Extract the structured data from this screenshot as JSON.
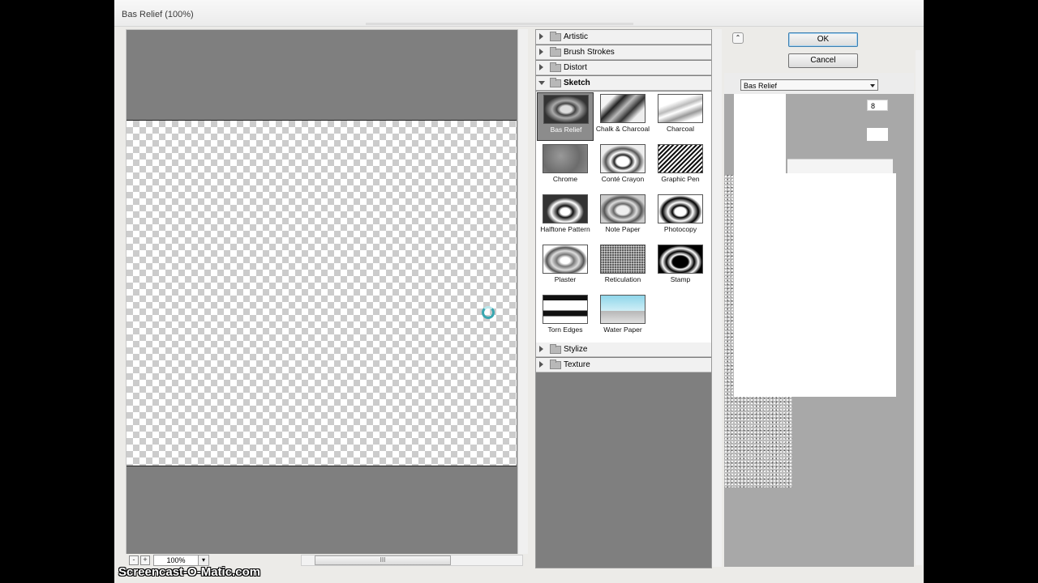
{
  "window": {
    "title": "Bas Relief (100%)"
  },
  "preview": {
    "zoom": "100%",
    "zoom_minus": "-",
    "zoom_plus": "+",
    "scroll_grip": "III"
  },
  "categories_top": [
    {
      "label": "Artistic",
      "open": false
    },
    {
      "label": "Brush Strokes",
      "open": false
    },
    {
      "label": "Distort",
      "open": false
    },
    {
      "label": "Sketch",
      "open": true
    }
  ],
  "sketch_filters": [
    {
      "label": "Bas Relief",
      "selected": true
    },
    {
      "label": "Chalk & Charcoal",
      "selected": false
    },
    {
      "label": "Charcoal",
      "selected": false
    },
    {
      "label": "Chrome",
      "selected": false
    },
    {
      "label": "Conté Crayon",
      "selected": false
    },
    {
      "label": "Graphic Pen",
      "selected": false
    },
    {
      "label": "Halftone Pattern",
      "selected": false
    },
    {
      "label": "Note Paper",
      "selected": false
    },
    {
      "label": "Photocopy",
      "selected": false
    },
    {
      "label": "Plaster",
      "selected": false
    },
    {
      "label": "Reticulation",
      "selected": false
    },
    {
      "label": "Stamp",
      "selected": false
    },
    {
      "label": "Torn Edges",
      "selected": false
    },
    {
      "label": "Water Paper",
      "selected": false
    }
  ],
  "categories_bottom": [
    {
      "label": "Stylize",
      "open": false
    },
    {
      "label": "Texture",
      "open": false
    }
  ],
  "buttons": {
    "ok": "OK",
    "cancel": "Cancel",
    "collapse": "⌃"
  },
  "settings": {
    "filter_select": "Bas Relief",
    "detail_value": "8"
  },
  "watermark": "Screencast-O-Matic.com"
}
